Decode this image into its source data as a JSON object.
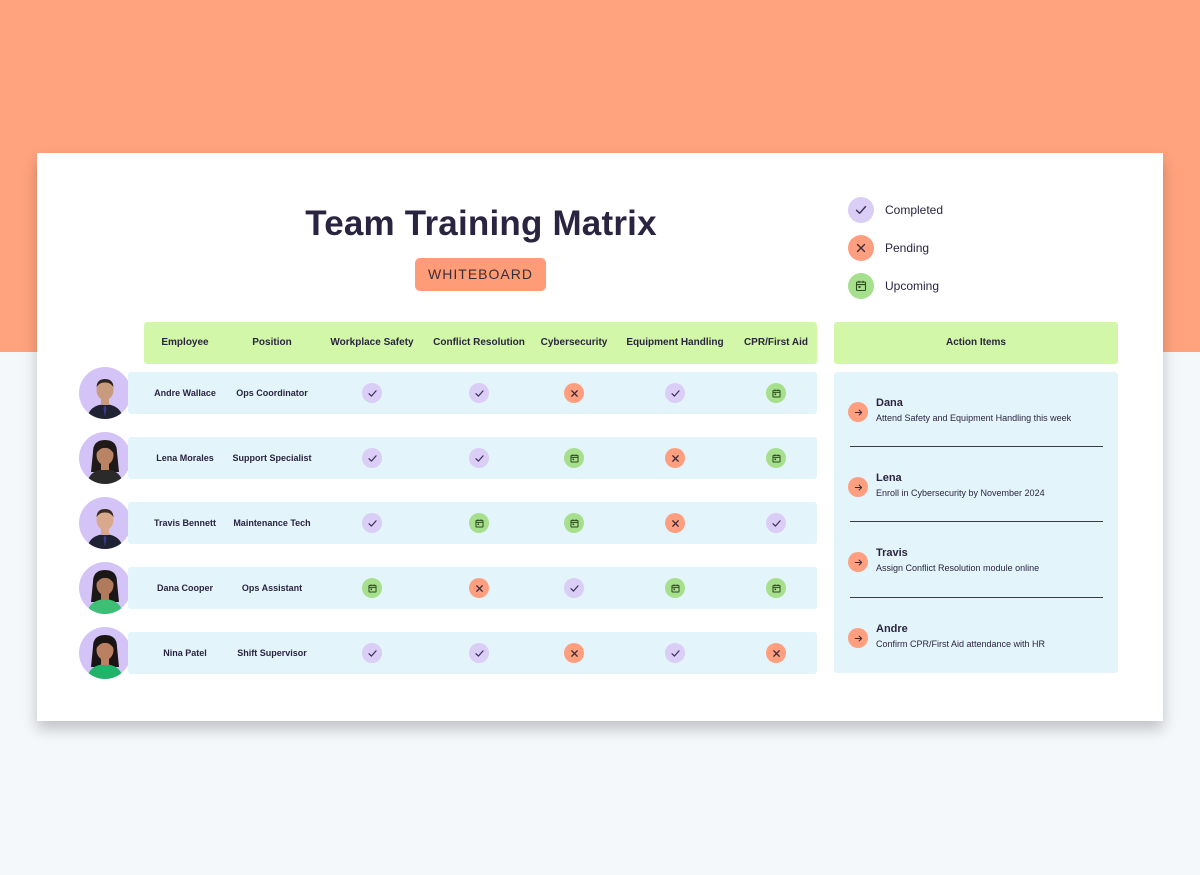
{
  "title": "Team Training Matrix",
  "badge": "WHITEBOARD",
  "legend": [
    {
      "status": "completed",
      "label": "Completed",
      "icon": "check-icon",
      "color": "#dacdf6"
    },
    {
      "status": "pending",
      "label": "Pending",
      "icon": "x-icon",
      "color": "#ff9f80"
    },
    {
      "status": "upcoming",
      "label": "Upcoming",
      "icon": "calendar-icon",
      "color": "#a6e08c"
    }
  ],
  "table": {
    "headers": [
      "Employee",
      "Position",
      "Workplace Safety",
      "Conflict Resolution",
      "Cybersecurity",
      "Equipment Handling",
      "CPR/First Aid"
    ],
    "rows": [
      {
        "employee": "Andre Wallace",
        "position": "Ops Coordinator",
        "statuses": [
          "completed",
          "completed",
          "pending",
          "completed",
          "upcoming"
        ]
      },
      {
        "employee": "Lena Morales",
        "position": "Support Specialist",
        "statuses": [
          "completed",
          "completed",
          "upcoming",
          "pending",
          "upcoming"
        ]
      },
      {
        "employee": "Travis Bennett",
        "position": "Maintenance Tech",
        "statuses": [
          "completed",
          "upcoming",
          "upcoming",
          "pending",
          "completed"
        ]
      },
      {
        "employee": "Dana Cooper",
        "position": "Ops Assistant",
        "statuses": [
          "upcoming",
          "pending",
          "completed",
          "upcoming",
          "upcoming"
        ]
      },
      {
        "employee": "Nina Patel",
        "position": "Shift Supervisor",
        "statuses": [
          "completed",
          "completed",
          "pending",
          "completed",
          "pending"
        ]
      }
    ]
  },
  "action_items": {
    "header": "Action Items",
    "items": [
      {
        "name": "Dana",
        "text": "Attend Safety and Equipment Handling this week"
      },
      {
        "name": "Lena",
        "text": "Enroll in Cybersecurity by November 2024"
      },
      {
        "name": "Travis",
        "text": "Assign Conflict Resolution module online"
      },
      {
        "name": "Andre",
        "text": "Confirm CPR/First Aid attendance with HR"
      }
    ]
  },
  "colors": {
    "background_top": "#ffa37e",
    "header_green": "#d2f7a8",
    "row_blue": "#e3f4fa",
    "completed": "#dacdf6",
    "pending": "#ff9f80",
    "upcoming": "#a6e08c"
  }
}
